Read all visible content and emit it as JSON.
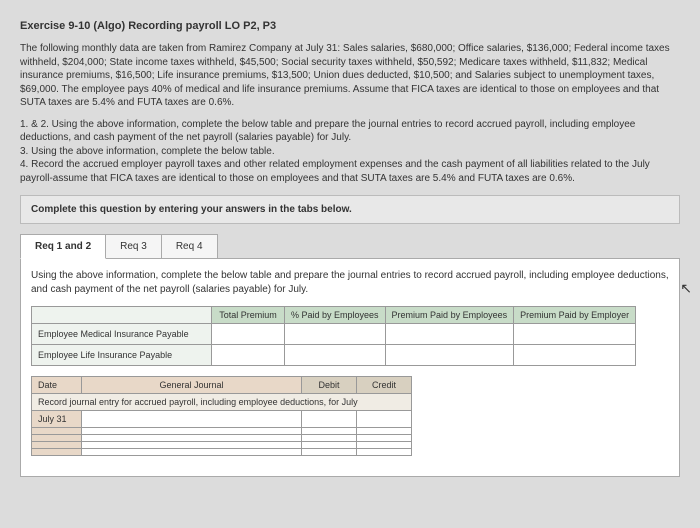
{
  "heading": "Exercise 9-10 (Algo) Recording payroll LO P2, P3",
  "intro": "The following monthly data are taken from Ramirez Company at July 31: Sales salaries, $680,000; Office salaries, $136,000; Federal income taxes withheld, $204,000; State income taxes withheld, $45,500; Social security taxes withheld, $50,592; Medicare taxes withheld, $11,832; Medical insurance premiums, $16,500; Life insurance premiums, $13,500; Union dues deducted, $10,500; and Salaries subject to unemployment taxes, $69,000. The employee pays 40% of medical and life insurance premiums. Assume that FICA taxes are identical to those on employees and that SUTA taxes are 5.4% and FUTA taxes are 0.6%.",
  "instructions": {
    "l1": "1. & 2. Using the above information, complete the below table and prepare the journal entries to record accrued payroll, including employee deductions, and cash payment of the net payroll (salaries payable) for July.",
    "l2": "3. Using the above information, complete the below table.",
    "l3": "4. Record the accrued employer payroll taxes and other related employment expenses and the cash payment of all liabilities related to the July payroll-assume that FICA taxes are identical to those on employees and that SUTA taxes are 5.4% and FUTA taxes are 0.6%."
  },
  "panel": "Complete this question by entering your answers in the tabs below.",
  "tabs": {
    "t1": "Req 1 and 2",
    "t2": "Req 3",
    "t3": "Req 4"
  },
  "tab_desc": "Using the above information, complete the below table and prepare the journal entries to record accrued payroll, including employee deductions, and cash payment of the net payroll (salaries payable) for July.",
  "table1": {
    "h1": "Total Premium",
    "h2": "% Paid by Employees",
    "h3": "Premium Paid by Employees",
    "h4": "Premium Paid by Employer",
    "r1": "Employee Medical Insurance Payable",
    "r2": "Employee Life Insurance Payable"
  },
  "table2": {
    "date_h": "Date",
    "gj_h": "General Journal",
    "debit_h": "Debit",
    "credit_h": "Credit",
    "desc": "Record journal entry for accrued payroll, including employee deductions, for July",
    "date_val": "July 31"
  }
}
